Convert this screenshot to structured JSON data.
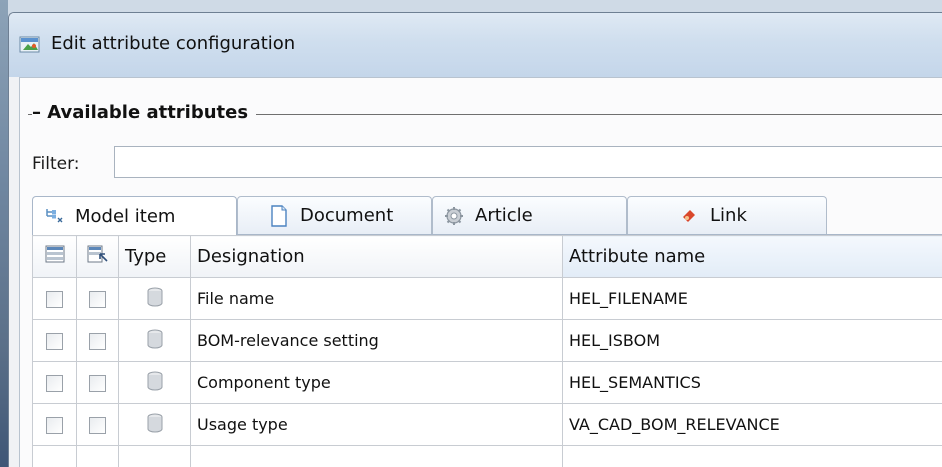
{
  "window": {
    "title": "Edit attribute configuration"
  },
  "group": {
    "title": "– Available attributes"
  },
  "filter": {
    "label": "Filter:",
    "value": ""
  },
  "tabs": [
    {
      "label": "Model item",
      "icon": "model-item-icon",
      "active": true
    },
    {
      "label": "Document",
      "icon": "document-icon",
      "active": false
    },
    {
      "label": "Article",
      "icon": "article-gear-icon",
      "active": false
    },
    {
      "label": "Link",
      "icon": "link-icon",
      "active": false
    }
  ],
  "grid": {
    "columns": {
      "select_all_icon": "list-select-icon",
      "select_pick_icon": "list-pick-icon",
      "type": "Type",
      "designation": "Designation",
      "attribute_name": "Attribute name"
    },
    "rows": [
      {
        "designation": "File name",
        "attribute_name": "HEL_FILENAME",
        "type_icon": "cylinder-icon",
        "checked_a": false,
        "checked_b": false
      },
      {
        "designation": "BOM-relevance setting",
        "attribute_name": "HEL_ISBOM",
        "type_icon": "cylinder-icon",
        "checked_a": false,
        "checked_b": false
      },
      {
        "designation": "Component type",
        "attribute_name": "HEL_SEMANTICS",
        "type_icon": "cylinder-icon",
        "checked_a": false,
        "checked_b": false
      },
      {
        "designation": "Usage type",
        "attribute_name": "VA_CAD_BOM_RELEVANCE",
        "type_icon": "cylinder-icon",
        "checked_a": false,
        "checked_b": false
      }
    ]
  },
  "colors": {
    "titlebar": "#cfdeee",
    "panel": "#fbfbfc",
    "grid_border": "#c8ccd2"
  }
}
